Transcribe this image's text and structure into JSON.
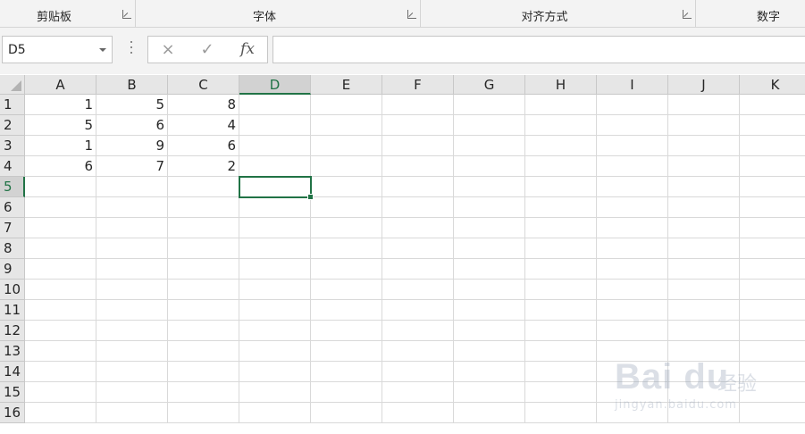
{
  "ribbon": {
    "groups": [
      "剪贴板",
      "字体",
      "对齐方式",
      "数字"
    ]
  },
  "formula_bar": {
    "name_box": "D5",
    "cancel_icon": "×",
    "enter_icon": "✓",
    "fx_label": "fx",
    "formula": ""
  },
  "sheet": {
    "columns": [
      "A",
      "B",
      "C",
      "D",
      "E",
      "F",
      "G",
      "H",
      "I",
      "J",
      "K"
    ],
    "rows": [
      "1",
      "2",
      "3",
      "4",
      "5",
      "6",
      "7",
      "8",
      "9",
      "10",
      "11",
      "12",
      "13",
      "14",
      "15",
      "16"
    ],
    "cells": [
      [
        "1",
        "5",
        "8"
      ],
      [
        "5",
        "6",
        "4"
      ],
      [
        "1",
        "9",
        "6"
      ],
      [
        "6",
        "7",
        "2"
      ]
    ],
    "selected_cell": "D5",
    "accent_color": "#217346"
  },
  "watermark": {
    "brand": "Bai  du",
    "brand_cn": "经验",
    "url": "jingyan.baidu.com"
  }
}
